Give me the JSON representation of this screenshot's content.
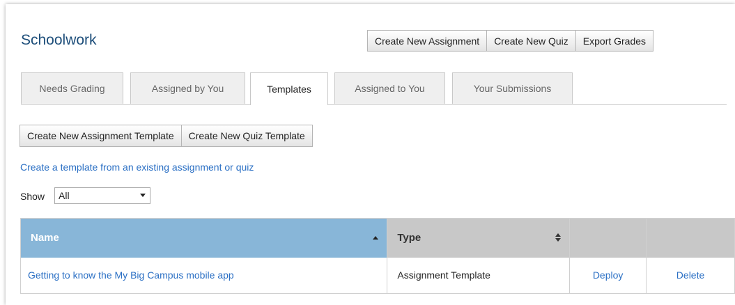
{
  "header": {
    "title": "Schoolwork"
  },
  "toolbar": {
    "create_assignment": "Create New Assignment",
    "create_quiz": "Create New Quiz",
    "export_grades": "Export Grades"
  },
  "tabs": [
    {
      "label": "Needs Grading",
      "active": false
    },
    {
      "label": "Assigned by You",
      "active": false
    },
    {
      "label": "Templates",
      "active": true
    },
    {
      "label": "Assigned to You",
      "active": false
    },
    {
      "label": "Your Submissions",
      "active": false
    }
  ],
  "templates_toolbar": {
    "create_assignment_template": "Create New Assignment Template",
    "create_quiz_template": "Create New Quiz Template"
  },
  "link_text": "Create a template from an existing assignment or quiz",
  "filter": {
    "label": "Show",
    "value": "All"
  },
  "table": {
    "columns": [
      "Name",
      "Type",
      "",
      ""
    ],
    "rows": [
      {
        "name": "Getting to know the My Big Campus mobile app",
        "type": "Assignment Template",
        "deploy": "Deploy",
        "delete": "Delete"
      }
    ]
  },
  "colors": {
    "accent_link": "#2a6fc4",
    "title": "#1d4e7a",
    "sorted_header": "#88b6d8"
  }
}
